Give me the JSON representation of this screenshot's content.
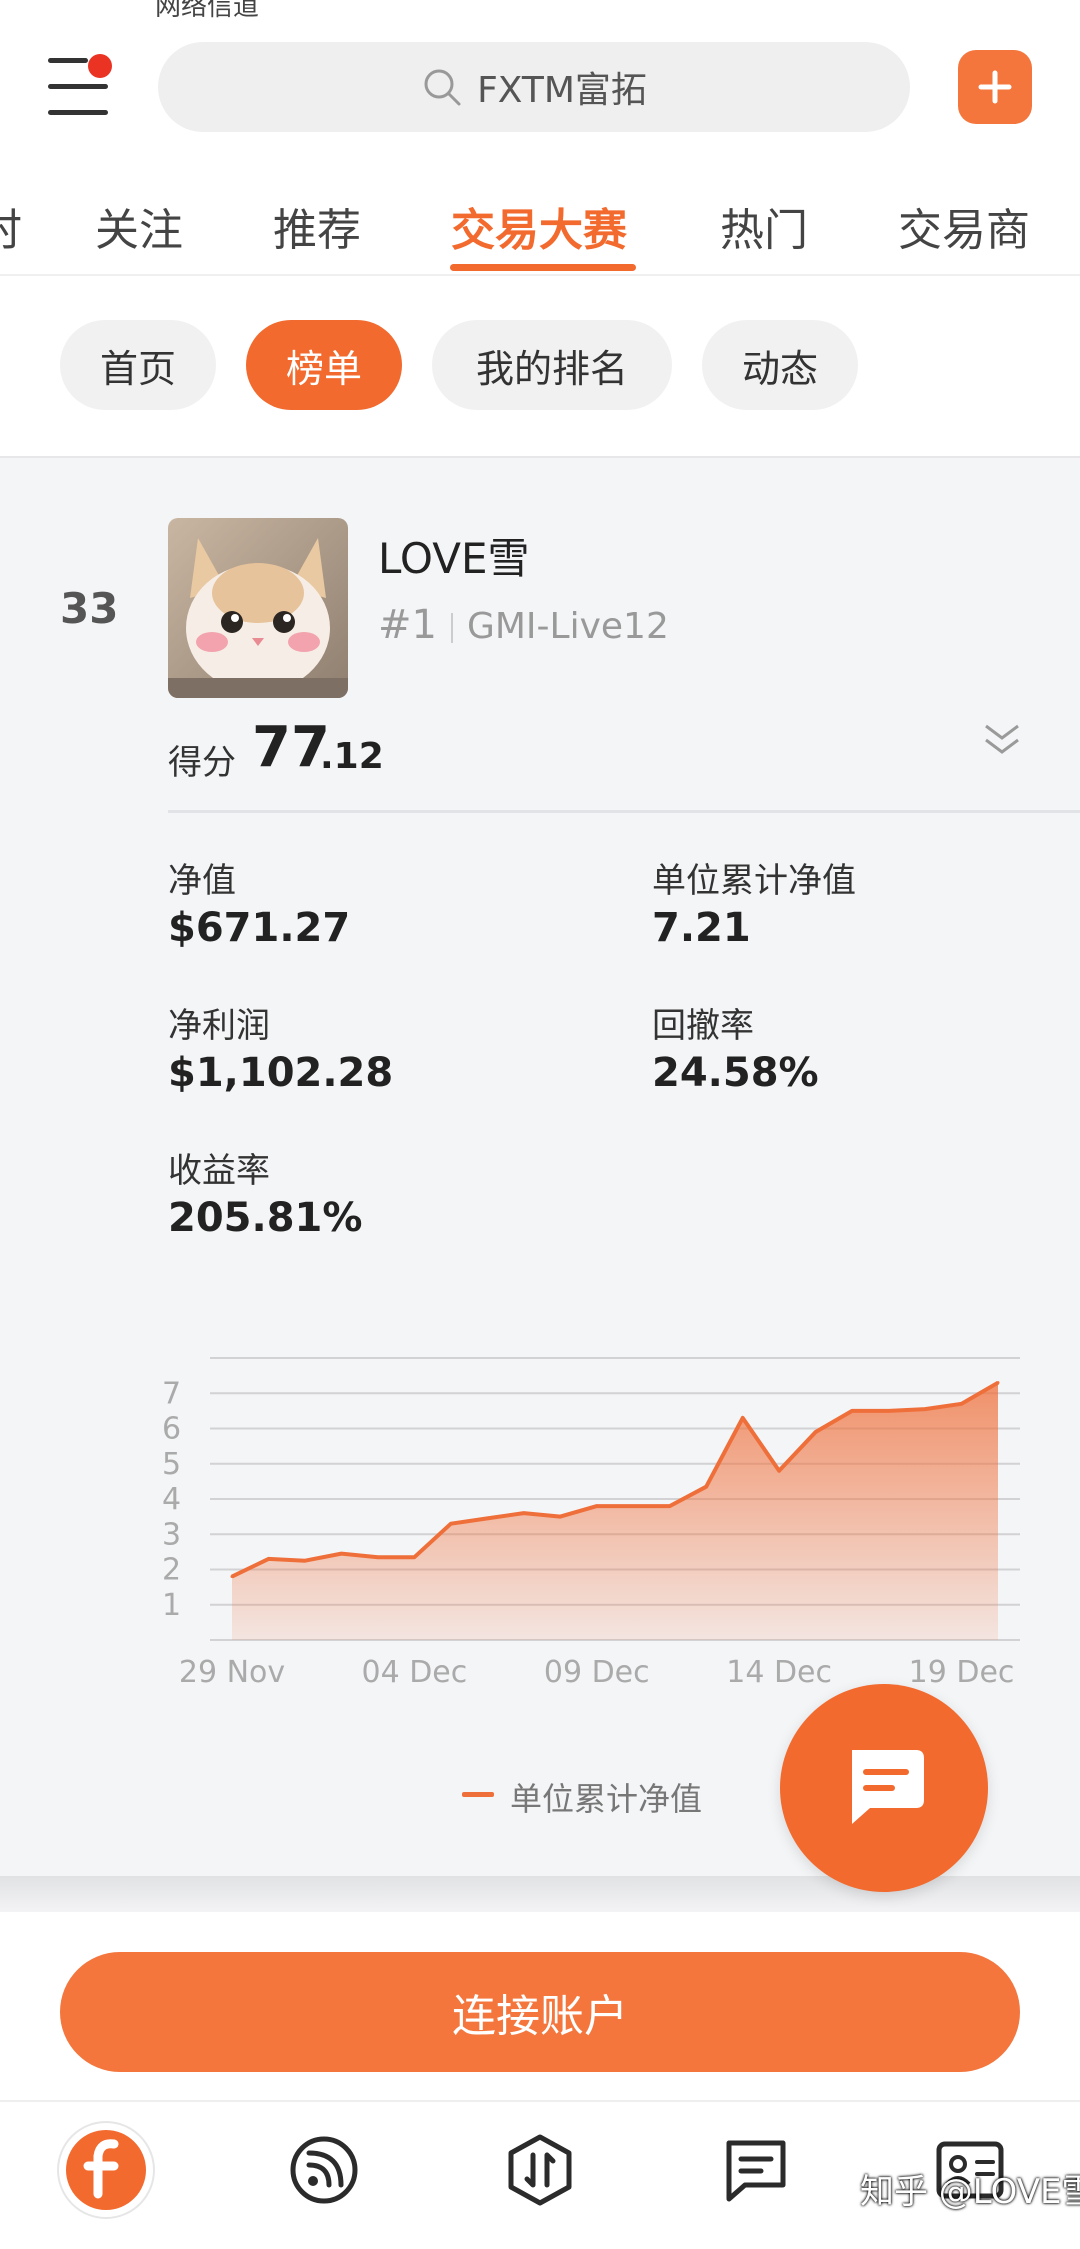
{
  "status_fragment": "网络信道",
  "header": {
    "search_placeholder": "FXTM富拓"
  },
  "tabs": [
    "时",
    "关注",
    "推荐",
    "交易大赛",
    "热门",
    "交易商"
  ],
  "active_tab": "交易大赛",
  "subtabs": [
    "首页",
    "榜单",
    "我的排名",
    "动态"
  ],
  "active_subtab": "榜单",
  "entry": {
    "rank": "33",
    "username": "LOVE雪",
    "hash_rank": "#1",
    "account": "GMI-Live12",
    "score_label": "得分",
    "score_int": "77",
    "score_dec": ".12"
  },
  "stats": {
    "net_value_label": "净值",
    "net_value": "$671.27",
    "unit_nav_label": "单位累计净值",
    "unit_nav": "7.21",
    "net_profit_label": "净利润",
    "net_profit": "$1,102.28",
    "drawdown_label": "回撤率",
    "drawdown": "24.58%",
    "return_label": "收益率",
    "return": "205.81%"
  },
  "chart_data": {
    "type": "area",
    "series_name": "单位累计净值",
    "x_ticks": [
      "29 Nov",
      "04 Dec",
      "09 Dec",
      "14 Dec",
      "19 Dec"
    ],
    "y_ticks": [
      1,
      2,
      3,
      4,
      5,
      6,
      7
    ],
    "ylim": [
      0,
      8
    ],
    "x": [
      "29 Nov",
      "30 Nov",
      "01 Dec",
      "02 Dec",
      "03 Dec",
      "04 Dec",
      "05 Dec",
      "06 Dec",
      "07 Dec",
      "08 Dec",
      "09 Dec",
      "10 Dec",
      "11 Dec",
      "12 Dec",
      "13 Dec",
      "14 Dec",
      "15 Dec",
      "16 Dec",
      "17 Dec",
      "18 Dec",
      "19 Dec",
      "20 Dec"
    ],
    "values": [
      1.8,
      2.3,
      2.25,
      2.45,
      2.35,
      2.35,
      3.3,
      3.45,
      3.6,
      3.5,
      3.8,
      3.8,
      3.8,
      4.35,
      6.3,
      4.8,
      5.9,
      6.5,
      6.5,
      6.55,
      6.7,
      7.3
    ],
    "color": "#ef6f3a",
    "grid": true
  },
  "connect_button": "连接账户",
  "watermark": "知乎 @LOVE雪",
  "colors": {
    "accent": "#f26a2e",
    "button": "#f4763d"
  }
}
